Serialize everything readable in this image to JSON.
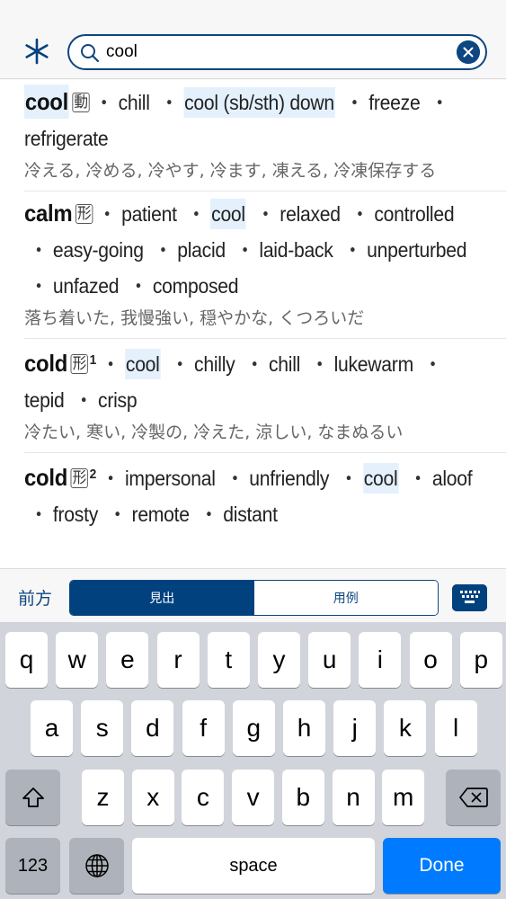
{
  "search": {
    "query": "cool",
    "icons": {
      "left": "asterisk-icon",
      "search": "search-icon",
      "clear": "clear-icon"
    }
  },
  "entries": [
    {
      "headword": "cool",
      "pos": "動",
      "sense": "",
      "synonyms": [
        {
          "text": "chill",
          "highlight": false
        },
        {
          "text": "cool (sb/sth) down",
          "highlight": true
        },
        {
          "text": "freeze",
          "highlight": false
        },
        {
          "text": "refrigerate",
          "highlight": false
        }
      ],
      "headword_highlight": true,
      "japanese": "冷える, 冷める, 冷やす, 冷ます, 凍える, 冷凍保存する"
    },
    {
      "headword": "calm",
      "pos": "形",
      "sense": "",
      "synonyms": [
        {
          "text": "patient",
          "highlight": false
        },
        {
          "text": "cool",
          "highlight": true
        },
        {
          "text": "relaxed",
          "highlight": false
        },
        {
          "text": "controlled",
          "highlight": false
        },
        {
          "text": "easy-going",
          "highlight": false
        },
        {
          "text": "placid",
          "highlight": false
        },
        {
          "text": "laid-back",
          "highlight": false
        },
        {
          "text": "unperturbed",
          "highlight": false
        },
        {
          "text": "unfazed",
          "highlight": false
        },
        {
          "text": "composed",
          "highlight": false
        }
      ],
      "headword_highlight": false,
      "japanese": "落ち着いた, 我慢強い, 穏やかな, くつろいだ"
    },
    {
      "headword": "cold",
      "pos": "形",
      "sense": "1",
      "synonyms": [
        {
          "text": "cool",
          "highlight": true
        },
        {
          "text": "chilly",
          "highlight": false
        },
        {
          "text": "chill",
          "highlight": false
        },
        {
          "text": "lukewarm",
          "highlight": false
        },
        {
          "text": "tepid",
          "highlight": false
        },
        {
          "text": "crisp",
          "highlight": false
        }
      ],
      "headword_highlight": false,
      "japanese": "冷たい, 寒い, 冷製の, 冷えた, 涼しい, なまぬるい"
    },
    {
      "headword": "cold",
      "pos": "形",
      "sense": "2",
      "synonyms": [
        {
          "text": "impersonal",
          "highlight": false
        },
        {
          "text": "unfriendly",
          "highlight": false
        },
        {
          "text": "cool",
          "highlight": true
        },
        {
          "text": "aloof",
          "highlight": false
        },
        {
          "text": "frosty",
          "highlight": false
        },
        {
          "text": "remote",
          "highlight": false
        },
        {
          "text": "distant",
          "highlight": false
        }
      ],
      "headword_highlight": false,
      "japanese": ""
    }
  ],
  "mode_bar": {
    "prefix_label": "前方",
    "segments": [
      {
        "label": "見出",
        "selected": true
      },
      {
        "label": "用例",
        "selected": false
      }
    ],
    "keyboard_icon": "keyboard-icon"
  },
  "keyboard": {
    "row1": [
      "q",
      "w",
      "e",
      "r",
      "t",
      "y",
      "u",
      "i",
      "o",
      "p"
    ],
    "row2": [
      "a",
      "s",
      "d",
      "f",
      "g",
      "h",
      "j",
      "k",
      "l"
    ],
    "row3": [
      "z",
      "x",
      "c",
      "v",
      "b",
      "n",
      "m"
    ],
    "numbers_label": "123",
    "space_label": "space",
    "done_label": "Done"
  },
  "colors": {
    "brand": "#00417e",
    "highlight": "#e4f1fd",
    "done": "#007aff"
  }
}
